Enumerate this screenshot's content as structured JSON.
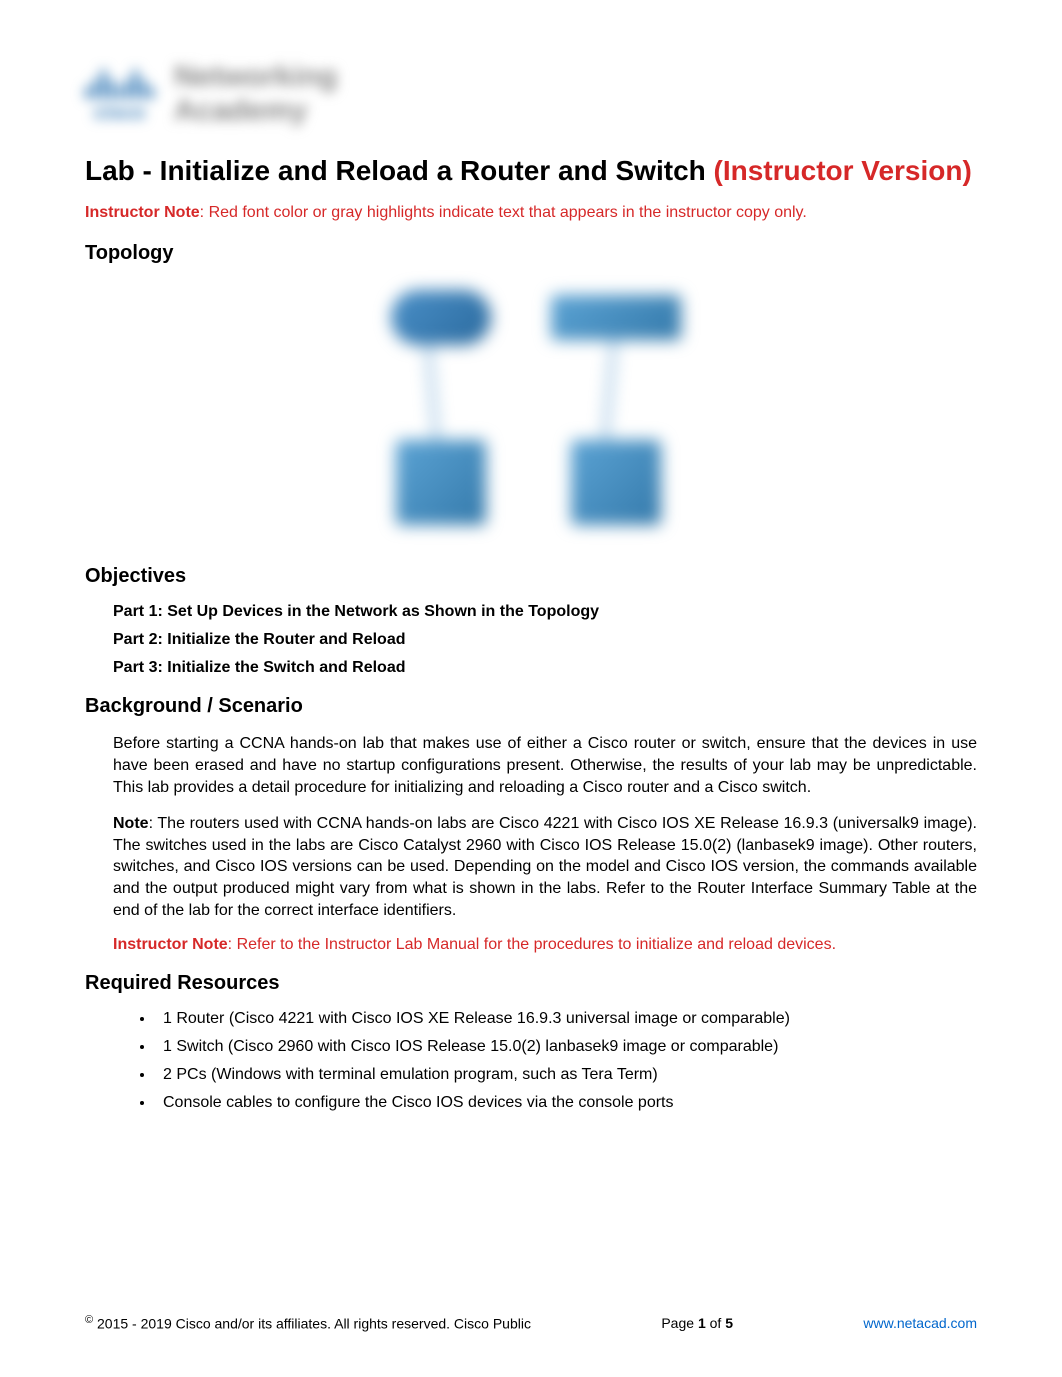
{
  "logo": {
    "brand": "cisco",
    "line1": "Networking",
    "line2": "Academy"
  },
  "title": {
    "black": "Lab - Initialize and Reload a Router and Switch ",
    "red": "(Instructor Version)"
  },
  "instructor_note_top": {
    "label": "Instructor Note",
    "text": ": Red font color or gray highlights indicate text that appears in the instructor copy only."
  },
  "sections": {
    "topology_heading": "Topology",
    "objectives_heading": "Objectives",
    "background_heading": "Background / Scenario",
    "resources_heading": "Required Resources"
  },
  "objectives": {
    "part1": "Part 1: Set Up Devices in the Network as Shown in the Topology",
    "part2": "Part 2: Initialize the Router and Reload",
    "part3": "Part 3: Initialize the Switch and Reload"
  },
  "background": {
    "para1": "Before starting a CCNA hands-on lab that makes use of either a Cisco router or switch, ensure that the devices in use have been erased and have no startup configurations present. Otherwise, the results of your lab may be unpredictable. This lab provides a detail procedure for initializing and reloading a Cisco router and a Cisco switch.",
    "note_label": "Note",
    "note_text": ": The routers used with CCNA hands-on labs are Cisco 4221 with Cisco IOS XE Release 16.9.3 (universalk9 image). The switches used in the labs are Cisco Catalyst 2960 with Cisco IOS Release 15.0(2) (lanbasek9 image). Other routers, switches, and Cisco IOS versions can be used. Depending on the model and Cisco IOS version, the commands available and the output produced might vary from what is shown in the labs. Refer to the Router Interface Summary Table at the end of the lab for the correct interface identifiers."
  },
  "instructor_note_mid": {
    "label": "Instructor Note",
    "text": ": Refer to the Instructor Lab Manual for the procedures to initialize and reload devices."
  },
  "resources": {
    "item1": "1 Router (Cisco 4221 with Cisco IOS XE Release 16.9.3 universal image or comparable)",
    "item2": "1 Switch (Cisco 2960 with Cisco IOS Release 15.0(2) lanbasek9 image or comparable)",
    "item3": "2 PCs (Windows with terminal emulation program, such as Tera Term)",
    "item4": "Console cables to configure the Cisco IOS devices via the console ports"
  },
  "footer": {
    "copyright": " 2015 - 2019 Cisco and/or its affiliates. All rights reserved. Cisco Public",
    "page_label": "Page ",
    "page_current": "1",
    "page_of": " of ",
    "page_total": "5",
    "link": "www.netacad.com"
  }
}
